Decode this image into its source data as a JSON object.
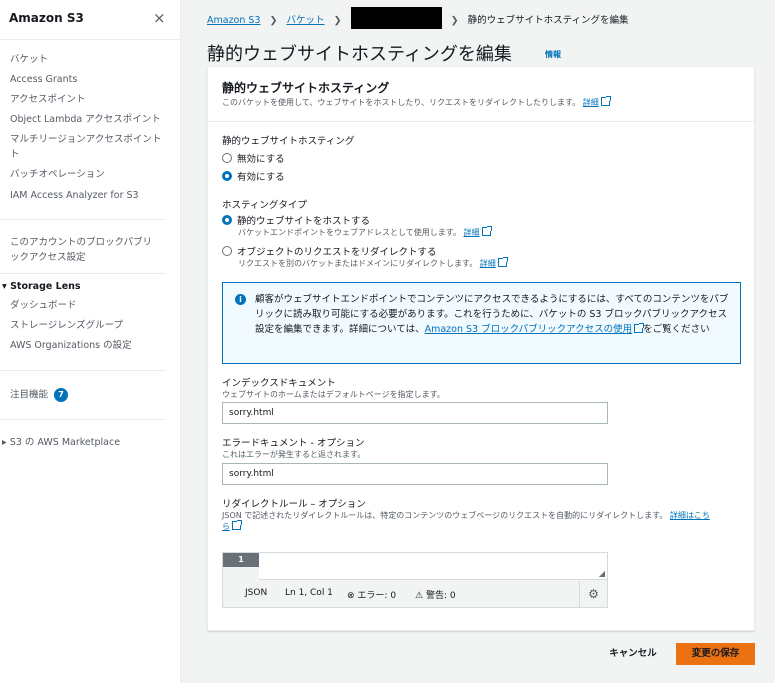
{
  "sidebar": {
    "title": "Amazon S3",
    "close_icon": "×",
    "items": [
      {
        "label": "バケット"
      },
      {
        "label": "Access Grants"
      },
      {
        "label": "アクセスポイント"
      },
      {
        "label": "Object Lambda アクセスポイント"
      },
      {
        "label": "マルチリージョンアクセスポイント"
      },
      {
        "label": "ト"
      },
      {
        "label": "バッチオペレーション"
      },
      {
        "label": "IAM Access Analyzer for S3"
      },
      {
        "label": "このアカウントのブロックパブリ"
      },
      {
        "label": "ックアクセス設定"
      }
    ],
    "storage_lens": {
      "label": "Storage Lens",
      "items": [
        {
          "label": "ダッシュボード"
        },
        {
          "label": "ストレージレンズグループ"
        },
        {
          "label": "AWS Organizations の設定"
        }
      ]
    },
    "featured": {
      "label": "注目機能",
      "count": "7"
    },
    "marketplace": {
      "label": "S3 の AWS Marketplace"
    }
  },
  "breadcrumb": {
    "s3": "Amazon S3",
    "buckets": "バケット",
    "current": "静的ウェブサイトホスティングを編集"
  },
  "page": {
    "title": "静的ウェブサイトホスティングを編集",
    "info": "情報"
  },
  "panel": {
    "title": "静的ウェブサイトホスティング",
    "description": "このバケットを使用して、ウェブサイトをホストしたり、リクエストをリダイレクトしたりします。",
    "details_link": "詳細"
  },
  "hosting": {
    "label": "静的ウェブサイトホスティング",
    "options": [
      {
        "label": "無効にする",
        "selected": false
      },
      {
        "label": "有効にする",
        "selected": true
      }
    ]
  },
  "hosting_type": {
    "label": "ホスティングタイプ",
    "options": [
      {
        "label": "静的ウェブサイトをホストする",
        "desc": "バケットエンドポイントをウェブアドレスとして使用します。",
        "link": "詳細",
        "selected": true
      },
      {
        "label": "オブジェクトのリクエストをリダイレクトする",
        "desc": "リクエストを別のバケットまたはドメインにリダイレクトします。",
        "link": "詳細",
        "selected": false
      }
    ]
  },
  "alert": {
    "text_before": "顧客がウェブサイトエンドポイントでコンテンツにアクセスできるようにするには、すべてのコンテンツをパブリックに読み取り可能にする必要があります。これを行うために、バケットの S3 ブロックパブリックアクセス設定を編集できます。詳細については、",
    "link": "Amazon S3 ブロックパブリックアクセスの使用",
    "text_after": "をご覧ください"
  },
  "index_doc": {
    "label": "インデックスドキュメント",
    "desc": "ウェブサイトのホームまたはデフォルトページを指定します。",
    "value": "sorry.html"
  },
  "error_doc": {
    "label": "エラードキュメント - オプション",
    "desc": "これはエラーが発生すると返されます。",
    "value": "sorry.html"
  },
  "redirect_rules": {
    "label": "リダイレクトルール – オプション",
    "desc": "JSON で記述されたリダイレクトルールは、特定のコンテンツのウェブページのリクエストを自動的にリダイレクトします。",
    "link_part1": "詳細はこち",
    "link_part2": "ら"
  },
  "editor": {
    "line_number": "1",
    "mode": "JSON",
    "position": "Ln 1, Col 1",
    "errors": "エラー: 0",
    "warnings": "警告: 0"
  },
  "actions": {
    "cancel": "キャンセル",
    "save": "変更の保存"
  },
  "colors": {
    "accent": "#0073bb",
    "primary_button": "#ec7211"
  }
}
